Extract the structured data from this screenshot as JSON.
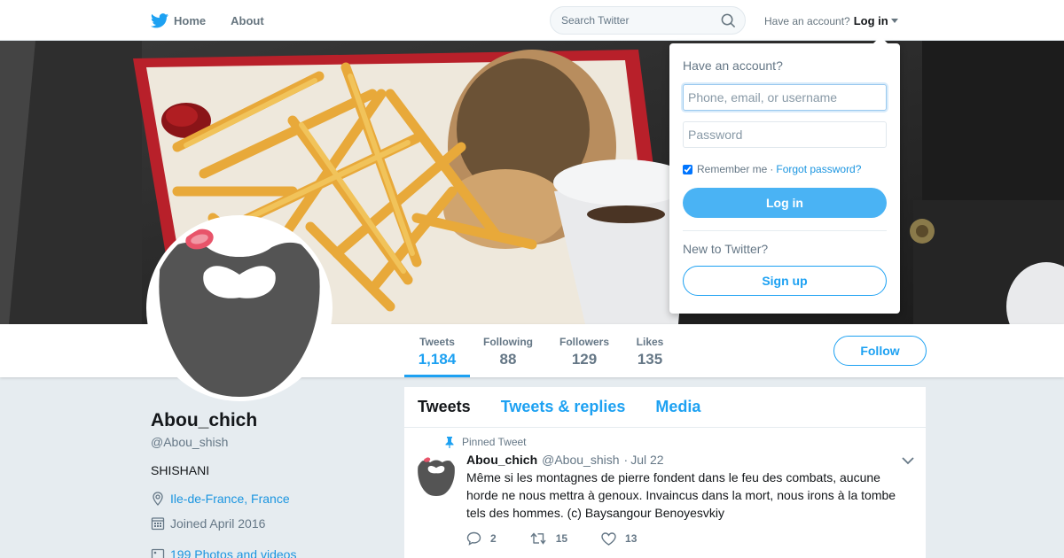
{
  "nav": {
    "home_label": "Home",
    "about_label": "About",
    "search_placeholder": "Search Twitter",
    "account_prompt": "Have an account?",
    "login_label": "Log in"
  },
  "stats": [
    {
      "label": "Tweets",
      "value": "1,184"
    },
    {
      "label": "Following",
      "value": "88"
    },
    {
      "label": "Followers",
      "value": "129"
    },
    {
      "label": "Likes",
      "value": "135"
    }
  ],
  "follow_label": "Follow",
  "profile": {
    "name": "Abou_chich",
    "handle": "@Abou_shish",
    "bio": "SHISHANI",
    "location": "Ile-de-France, France",
    "joined": "Joined April 2016",
    "photos": "199 Photos and videos"
  },
  "tabs": [
    "Tweets",
    "Tweets & replies",
    "Media"
  ],
  "tweet": {
    "pinned_label": "Pinned Tweet",
    "author": "Abou_chich",
    "handle": "@Abou_shish",
    "dot": "·",
    "time": "Jul 22",
    "text": "Même si les montagnes de pierre fondent dans le feu des combats, aucune horde ne nous mettra à genoux. Invaincus dans la mort, nous irons à la tombe tels des hommes. (c) Baysangour Benoyesvkiy",
    "replies": "2",
    "retweets": "15",
    "likes": "13"
  },
  "login_dropdown": {
    "title": "Have an account?",
    "username_placeholder": "Phone, email, or username",
    "password_placeholder": "Password",
    "remember_label": "Remember me",
    "separator": "·",
    "forgot_label": "Forgot password?",
    "login_button": "Log in",
    "new_label": "New to Twitter?",
    "signup_button": "Sign up"
  },
  "colors": {
    "accent": "#1da1f2",
    "background": "#e6ecf0",
    "text": "#14171a",
    "muted": "#657786"
  }
}
